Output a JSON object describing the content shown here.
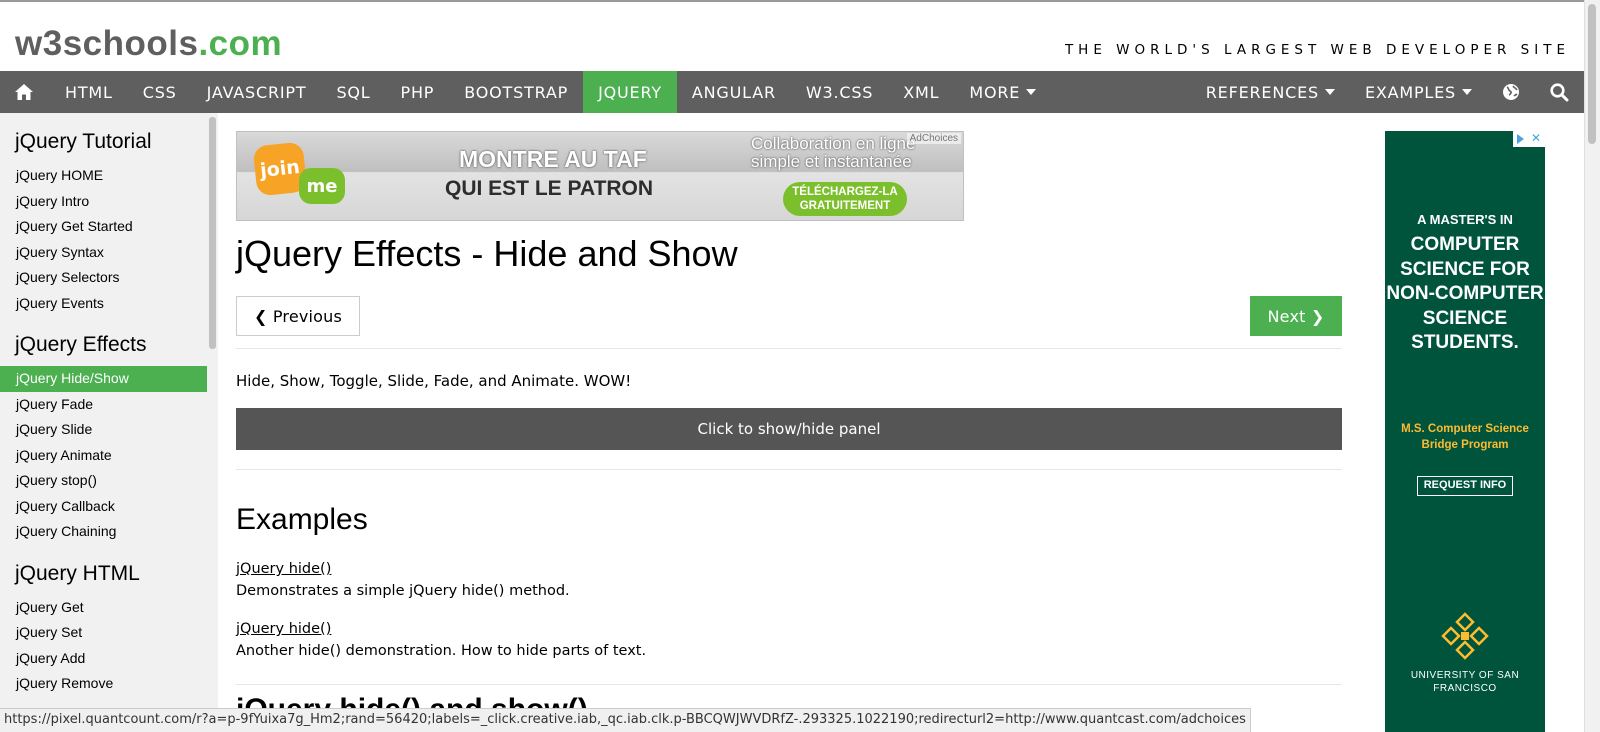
{
  "header": {
    "logo_main": "w3schools",
    "logo_dotcom": ".com",
    "tagline": "THE WORLD'S LARGEST WEB DEVELOPER SITE"
  },
  "topnav": {
    "home_icon": "home-icon",
    "items": [
      {
        "label": "HTML"
      },
      {
        "label": "CSS"
      },
      {
        "label": "JAVASCRIPT"
      },
      {
        "label": "SQL"
      },
      {
        "label": "PHP"
      },
      {
        "label": "BOOTSTRAP"
      },
      {
        "label": "JQUERY",
        "active": true
      },
      {
        "label": "ANGULAR"
      },
      {
        "label": "W3.CSS"
      },
      {
        "label": "XML"
      },
      {
        "label": "MORE"
      }
    ],
    "right_items": [
      {
        "label": "REFERENCES"
      },
      {
        "label": "EXAMPLES"
      }
    ],
    "globe_icon": "globe-icon",
    "search_icon": "search-icon",
    "active_color": "#4caf50",
    "bar_color": "#5f5f5f"
  },
  "sidebar": {
    "sections": [
      {
        "heading": "jQuery Tutorial",
        "links": [
          "jQuery HOME",
          "jQuery Intro",
          "jQuery Get Started",
          "jQuery Syntax",
          "jQuery Selectors",
          "jQuery Events"
        ]
      },
      {
        "heading": "jQuery Effects",
        "links": [
          "jQuery Hide/Show",
          "jQuery Fade",
          "jQuery Slide",
          "jQuery Animate",
          "jQuery stop()",
          "jQuery Callback",
          "jQuery Chaining"
        ]
      },
      {
        "heading": "jQuery HTML",
        "links": [
          "jQuery Get",
          "jQuery Set",
          "jQuery Add",
          "jQuery Remove"
        ]
      }
    ],
    "active_link": "jQuery Hide/Show"
  },
  "ad_banner": {
    "logo_join": "join",
    "logo_me": "me",
    "line1": "MONTRE AU TAF",
    "line2": "QUI EST LE PATRON",
    "collab": "Collaboration en ligne simple et instantanée",
    "button": "TÉLÉCHARGEZ-LA GRATUITEMENT",
    "adchoices": "AdChoices"
  },
  "main": {
    "title": "jQuery Effects - Hide and Show",
    "prev_label": "❮ Previous",
    "next_label": "Next ❯",
    "intro": "Hide, Show, Toggle, Slide, Fade, and Animate. WOW!",
    "panel_button": "Click to show/hide panel",
    "examples_heading": "Examples",
    "examples": [
      {
        "link": "jQuery hide()",
        "desc": "Demonstrates a simple jQuery hide() method."
      },
      {
        "link": "jQuery hide()",
        "desc": "Another hide() demonstration. How to hide parts of text."
      }
    ],
    "next_heading_partial": "jQuery hide() and show()"
  },
  "side_ad": {
    "small": "A MASTER'S IN",
    "big": "COMPUTER SCIENCE FOR NON-COMPUTER SCIENCE STUDENTS.",
    "gold": "M.S. Computer Science Bridge Program",
    "button": "REQUEST INFO",
    "university": "UNIVERSITY OF SAN FRANCISCO",
    "bg_color": "#00543c",
    "gold_color": "#fdbb30"
  },
  "statusbar": {
    "url": "https://pixel.quantcount.com/r?a=p-9fYuixa7g_Hm2;rand=56420;labels=_click.creative.iab,_qc.iab.clk.p-BBCQWJWVDRfZ-.293325.1022190;redirecturl2=http://www.quantcast.com/adchoices"
  }
}
